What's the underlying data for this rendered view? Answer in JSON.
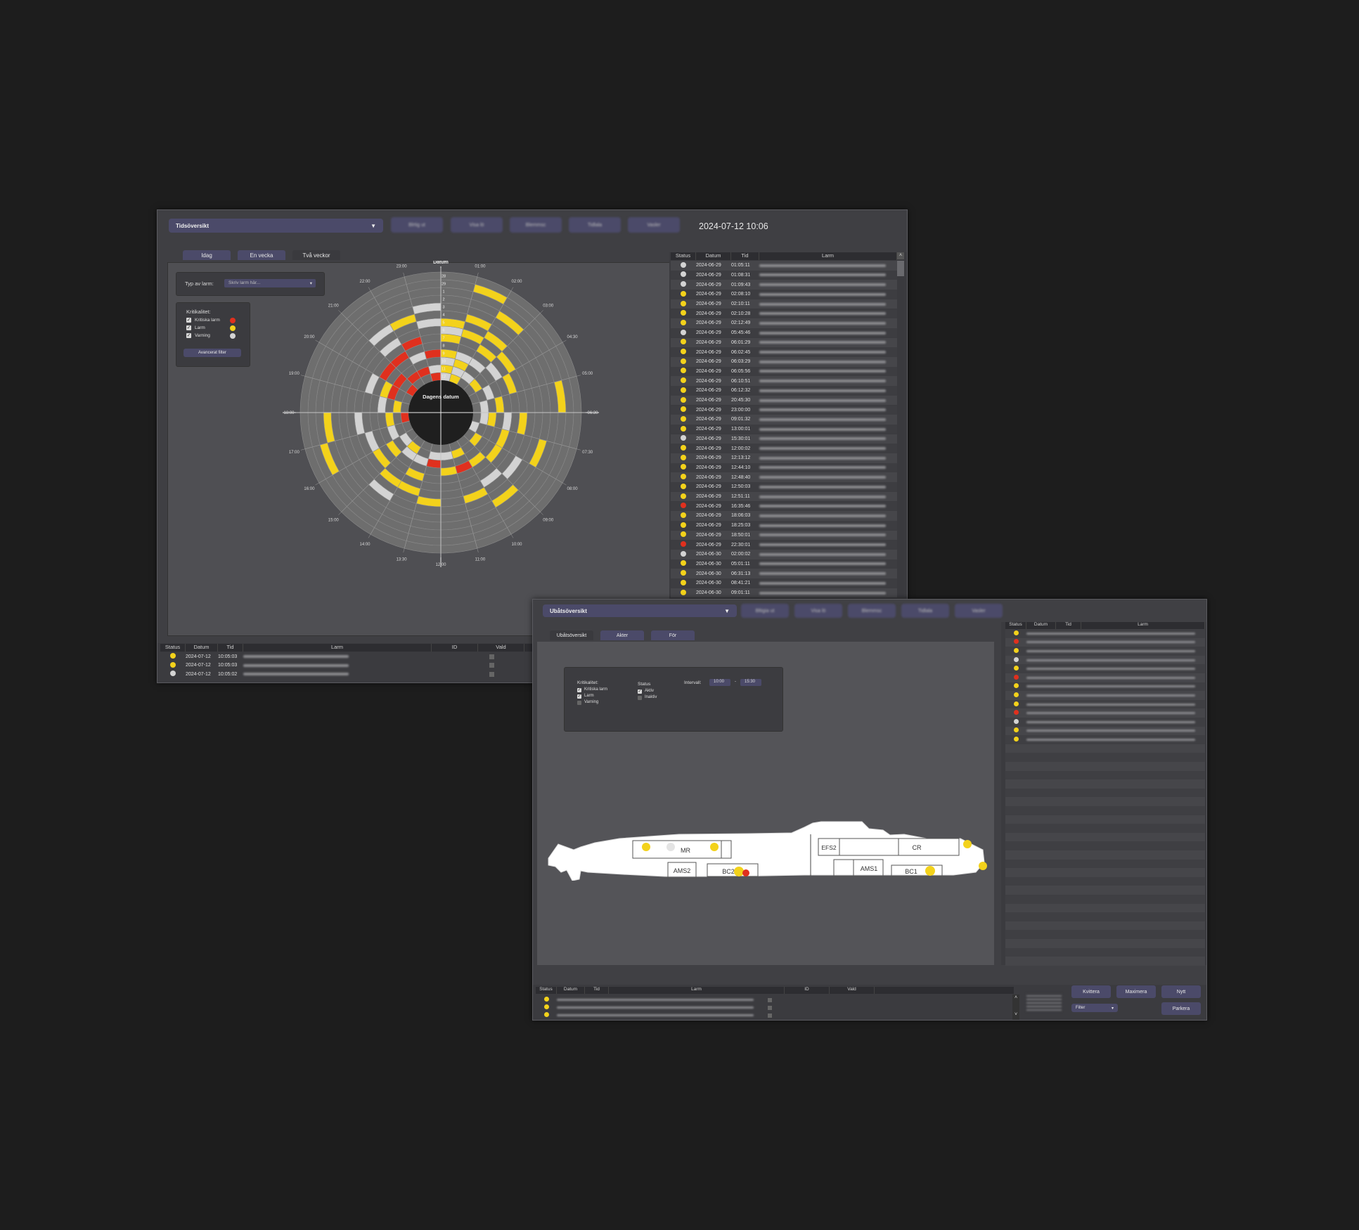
{
  "win1": {
    "view_select": "Tidsöversikt",
    "toolbar_buttons": [
      "Blrtig ut",
      "Visa lö",
      "Blemmsc",
      "Tidlala",
      "Vasler"
    ],
    "clock": "2024-07-12 10:06",
    "tabs": [
      "Idag",
      "En vecka",
      "Två veckor"
    ],
    "filter_label": "Typ av larm:",
    "filter_placeholder": "Skriv larm här...",
    "criticality_title": "Kritikalitet:",
    "criticality_items": [
      {
        "label": "Kritiska larm",
        "color": "#e0301e"
      },
      {
        "label": "Larm",
        "color": "#f3d21b"
      },
      {
        "label": "Varning",
        "color": "#d3d3d3"
      }
    ],
    "advanced_filter": "Avancerat filter",
    "chart_data": {
      "type": "heatmap",
      "title": "Datum",
      "center_label": "Dagens datum",
      "hour_labels": [
        "00:00",
        "01:00",
        "02:00",
        "03:00",
        "04:30",
        "05:00",
        "06:30",
        "07:30",
        "08:00",
        "09:00",
        "10:00",
        "11:00",
        "12:00",
        "13:30",
        "14:00",
        "15:00",
        "16:00",
        "17:00",
        "18:00",
        "19:00",
        "20:00",
        "21:00",
        "22:00",
        "23:00"
      ],
      "ring_labels": [
        "1",
        "2",
        "3",
        "4",
        "5",
        "6",
        "7",
        "8",
        "9",
        "10",
        "11",
        "12",
        "28",
        "29"
      ],
      "colors": {
        "critical": "#e0301e",
        "alarm": "#f3d21b",
        "warning": "#d3d3d3",
        "empty": "#6e6e6e"
      },
      "rings": 14,
      "sectors": 24,
      "cells": [
        [
          2,
          1,
          2,
          14,
          0,
          1,
          2,
          1,
          0,
          0,
          0,
          0,
          0,
          0
        ],
        [
          1,
          2,
          1,
          2,
          0,
          0,
          1,
          0,
          1,
          0,
          0,
          0,
          1,
          0
        ],
        [
          0,
          2,
          0,
          2,
          0,
          1,
          0,
          1,
          0,
          0,
          1,
          0,
          0,
          0
        ],
        [
          0,
          1,
          0,
          0,
          2,
          0,
          1,
          0,
          0,
          0,
          0,
          0,
          0,
          0
        ],
        [
          0,
          0,
          2,
          0,
          0,
          1,
          0,
          0,
          0,
          0,
          0,
          0,
          0,
          0
        ],
        [
          0,
          2,
          0,
          1,
          0,
          0,
          0,
          0,
          0,
          0,
          0,
          1,
          0,
          0
        ],
        [
          0,
          2,
          1,
          0,
          2,
          0,
          1,
          0,
          0,
          0,
          0,
          0,
          0,
          0
        ],
        [
          2,
          0,
          0,
          0,
          1,
          0,
          0,
          0,
          0,
          1,
          0,
          0,
          0,
          0
        ],
        [
          0,
          1,
          0,
          0,
          1,
          0,
          0,
          2,
          0,
          0,
          0,
          0,
          0,
          0
        ],
        [
          0,
          0,
          0,
          1,
          0,
          0,
          2,
          0,
          0,
          1,
          0,
          0,
          0,
          0
        ],
        [
          0,
          1,
          0,
          3,
          0,
          0,
          0,
          1,
          0,
          0,
          0,
          0,
          0,
          0
        ],
        [
          0,
          2,
          0,
          1,
          0,
          0,
          0,
          0,
          0,
          0,
          0,
          0,
          0,
          0
        ],
        [
          0,
          2,
          3,
          0,
          0,
          0,
          0,
          1,
          0,
          0,
          0,
          0,
          0,
          0
        ],
        [
          0,
          0,
          2,
          0,
          1,
          0,
          1,
          0,
          0,
          0,
          0,
          0,
          0,
          0
        ],
        [
          0,
          1,
          2,
          0,
          0,
          0,
          1,
          0,
          2,
          0,
          0,
          0,
          0,
          0
        ],
        [
          0,
          2,
          0,
          1,
          0,
          1,
          0,
          0,
          0,
          0,
          0,
          0,
          0,
          0
        ],
        [
          0,
          0,
          2,
          0,
          0,
          2,
          0,
          0,
          0,
          0,
          0,
          1,
          0,
          0
        ],
        [
          3,
          0,
          1,
          0,
          0,
          0,
          2,
          0,
          0,
          0,
          1,
          0,
          0,
          0
        ],
        [
          0,
          1,
          0,
          2,
          0,
          0,
          0,
          0,
          0,
          0,
          0,
          0,
          0,
          0
        ],
        [
          0,
          0,
          3,
          1,
          0,
          2,
          0,
          0,
          0,
          0,
          0,
          0,
          0,
          0
        ],
        [
          3,
          0,
          3,
          0,
          3,
          0,
          0,
          0,
          0,
          0,
          0,
          0,
          0,
          0
        ],
        [
          0,
          3,
          0,
          0,
          3,
          0,
          2,
          0,
          2,
          0,
          0,
          0,
          0,
          0
        ],
        [
          0,
          3,
          0,
          2,
          0,
          3,
          0,
          0,
          1,
          0,
          0,
          0,
          0,
          0
        ],
        [
          3,
          2,
          0,
          3,
          0,
          0,
          0,
          2,
          0,
          2,
          0,
          0,
          0,
          0
        ]
      ]
    },
    "side_table": {
      "headers": [
        "Status",
        "Datum",
        "Tid",
        "Larm"
      ],
      "rows": [
        {
          "s": "warning",
          "d": "2024-06-29",
          "t": "01:05:11"
        },
        {
          "s": "warning",
          "d": "2024-06-29",
          "t": "01:08:31"
        },
        {
          "s": "warning",
          "d": "2024-06-29",
          "t": "01:09:43"
        },
        {
          "s": "alarm",
          "d": "2024-06-29",
          "t": "02:08:10"
        },
        {
          "s": "alarm",
          "d": "2024-06-29",
          "t": "02:10:11"
        },
        {
          "s": "alarm",
          "d": "2024-06-29",
          "t": "02:10:28"
        },
        {
          "s": "alarm",
          "d": "2024-06-29",
          "t": "02:12:49"
        },
        {
          "s": "warning",
          "d": "2024-06-29",
          "t": "05:45:46"
        },
        {
          "s": "alarm",
          "d": "2024-06-29",
          "t": "06:01:29"
        },
        {
          "s": "alarm",
          "d": "2024-06-29",
          "t": "06:02:45"
        },
        {
          "s": "alarm",
          "d": "2024-06-29",
          "t": "06:03:29"
        },
        {
          "s": "alarm",
          "d": "2024-06-29",
          "t": "06:05:56"
        },
        {
          "s": "alarm",
          "d": "2024-06-29",
          "t": "06:10:51"
        },
        {
          "s": "alarm",
          "d": "2024-06-29",
          "t": "06:12:32"
        },
        {
          "s": "alarm",
          "d": "2024-06-29",
          "t": "20:45:30"
        },
        {
          "s": "alarm",
          "d": "2024-06-29",
          "t": "23:00:00"
        },
        {
          "s": "alarm",
          "d": "2024-06-29",
          "t": "09:01:32"
        },
        {
          "s": "alarm",
          "d": "2024-06-29",
          "t": "13:00:01"
        },
        {
          "s": "warning",
          "d": "2024-06-29",
          "t": "15:30:01"
        },
        {
          "s": "alarm",
          "d": "2024-06-29",
          "t": "12:00:02"
        },
        {
          "s": "alarm",
          "d": "2024-06-29",
          "t": "12:13:12"
        },
        {
          "s": "alarm",
          "d": "2024-06-29",
          "t": "12:44:10"
        },
        {
          "s": "alarm",
          "d": "2024-06-29",
          "t": "12:48:40"
        },
        {
          "s": "alarm",
          "d": "2024-06-29",
          "t": "12:50:03"
        },
        {
          "s": "alarm",
          "d": "2024-06-29",
          "t": "12:51:11"
        },
        {
          "s": "critical",
          "d": "2024-06-29",
          "t": "16:35:46"
        },
        {
          "s": "alarm",
          "d": "2024-06-29",
          "t": "18:06:03"
        },
        {
          "s": "alarm",
          "d": "2024-06-29",
          "t": "18:25:03"
        },
        {
          "s": "alarm",
          "d": "2024-06-29",
          "t": "18:50:01"
        },
        {
          "s": "critical",
          "d": "2024-06-29",
          "t": "22:30:01"
        },
        {
          "s": "warning",
          "d": "2024-06-30",
          "t": "02:00:02"
        },
        {
          "s": "alarm",
          "d": "2024-06-30",
          "t": "05:01:11"
        },
        {
          "s": "alarm",
          "d": "2024-06-30",
          "t": "06:31:13"
        },
        {
          "s": "alarm",
          "d": "2024-06-30",
          "t": "08:41:21"
        },
        {
          "s": "alarm",
          "d": "2024-06-30",
          "t": "09:01:11"
        }
      ]
    },
    "bottom_table": {
      "headers": [
        "Status",
        "Datum",
        "Tid",
        "Larm",
        "ID",
        "Vald"
      ],
      "rows": [
        {
          "s": "alarm",
          "d": "2024-07-12",
          "t": "10:05:03"
        },
        {
          "s": "alarm",
          "d": "2024-07-12",
          "t": "10:05:03"
        },
        {
          "s": "warning",
          "d": "2024-07-12",
          "t": "10:05:02"
        }
      ]
    }
  },
  "win2": {
    "view_select": "Ubåtsöversikt",
    "toolbar_buttons": [
      "Bltigia ut",
      "Visa lö",
      "Blemmsc",
      "Tidlala",
      "Vasler"
    ],
    "tabs": [
      "Ubåtsöversikt",
      "Akter",
      "För"
    ],
    "criticality_title": "Kritikalitet:",
    "criticality_items": [
      "Kritiska larm",
      "Larm",
      "Varning"
    ],
    "status_title": "Status",
    "status_items": [
      "Aktiv",
      "Inaktiv"
    ],
    "interval_label": "Intervall:",
    "interval_from": "10:00",
    "interval_sep": "-",
    "interval_to": "15:30",
    "compartments": [
      "MR",
      "AMS2",
      "BC2",
      "EFS2",
      "CR",
      "AMS1",
      "BC1"
    ],
    "side_headers": [
      "Status",
      "Datum",
      "Tid",
      "Larm"
    ],
    "side_status": [
      "alarm",
      "critical",
      "alarm",
      "warning",
      "alarm",
      "critical",
      "alarm",
      "alarm",
      "alarm",
      "critical",
      "warning",
      "alarm",
      "alarm"
    ],
    "bottom_headers": [
      "Status",
      "Datum",
      "Tid",
      "Larm",
      "ID",
      "Vald"
    ],
    "bottom_status": [
      "alarm",
      "alarm",
      "alarm"
    ],
    "buttons": {
      "ack": "Kvittera",
      "maximize": "Maximera",
      "new": "Nytt",
      "park": "Parkera",
      "filter": "Filter"
    }
  },
  "colors": {
    "critical": "#e0301e",
    "alarm": "#f3d21b",
    "warning": "#d3d3d3"
  }
}
